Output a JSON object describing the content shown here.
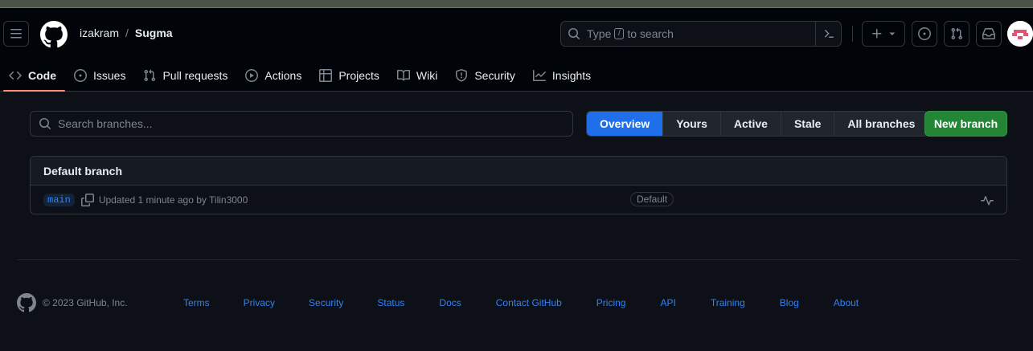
{
  "header": {
    "owner": "izakram",
    "separator": "/",
    "repo": "Sugma",
    "search_placeholder_prefix": "Type",
    "search_kbd": "/",
    "search_placeholder_suffix": "to search"
  },
  "nav": {
    "tabs": [
      {
        "label": "Code",
        "icon": "code-icon"
      },
      {
        "label": "Issues",
        "icon": "issue-icon"
      },
      {
        "label": "Pull requests",
        "icon": "pull-request-icon"
      },
      {
        "label": "Actions",
        "icon": "play-icon"
      },
      {
        "label": "Projects",
        "icon": "table-icon"
      },
      {
        "label": "Wiki",
        "icon": "book-icon"
      },
      {
        "label": "Security",
        "icon": "shield-icon"
      },
      {
        "label": "Insights",
        "icon": "graph-icon"
      }
    ]
  },
  "branches": {
    "search_placeholder": "Search branches...",
    "filters": [
      "Overview",
      "Yours",
      "Active",
      "Stale",
      "All branches"
    ],
    "new_branch_label": "New branch",
    "section_title": "Default branch",
    "default_branch": {
      "name": "main",
      "updated_text": "Updated 1 minute ago by Tilin3000",
      "badge": "Default"
    }
  },
  "footer": {
    "copyright": "© 2023 GitHub, Inc.",
    "links": [
      "Terms",
      "Privacy",
      "Security",
      "Status",
      "Docs",
      "Contact GitHub",
      "Pricing",
      "API",
      "Training",
      "Blog",
      "About"
    ]
  },
  "colors": {
    "accent": "#1f6feb",
    "primary_button": "#238636",
    "tab_underline": "#fd8c73",
    "link": "#2f81f7"
  }
}
